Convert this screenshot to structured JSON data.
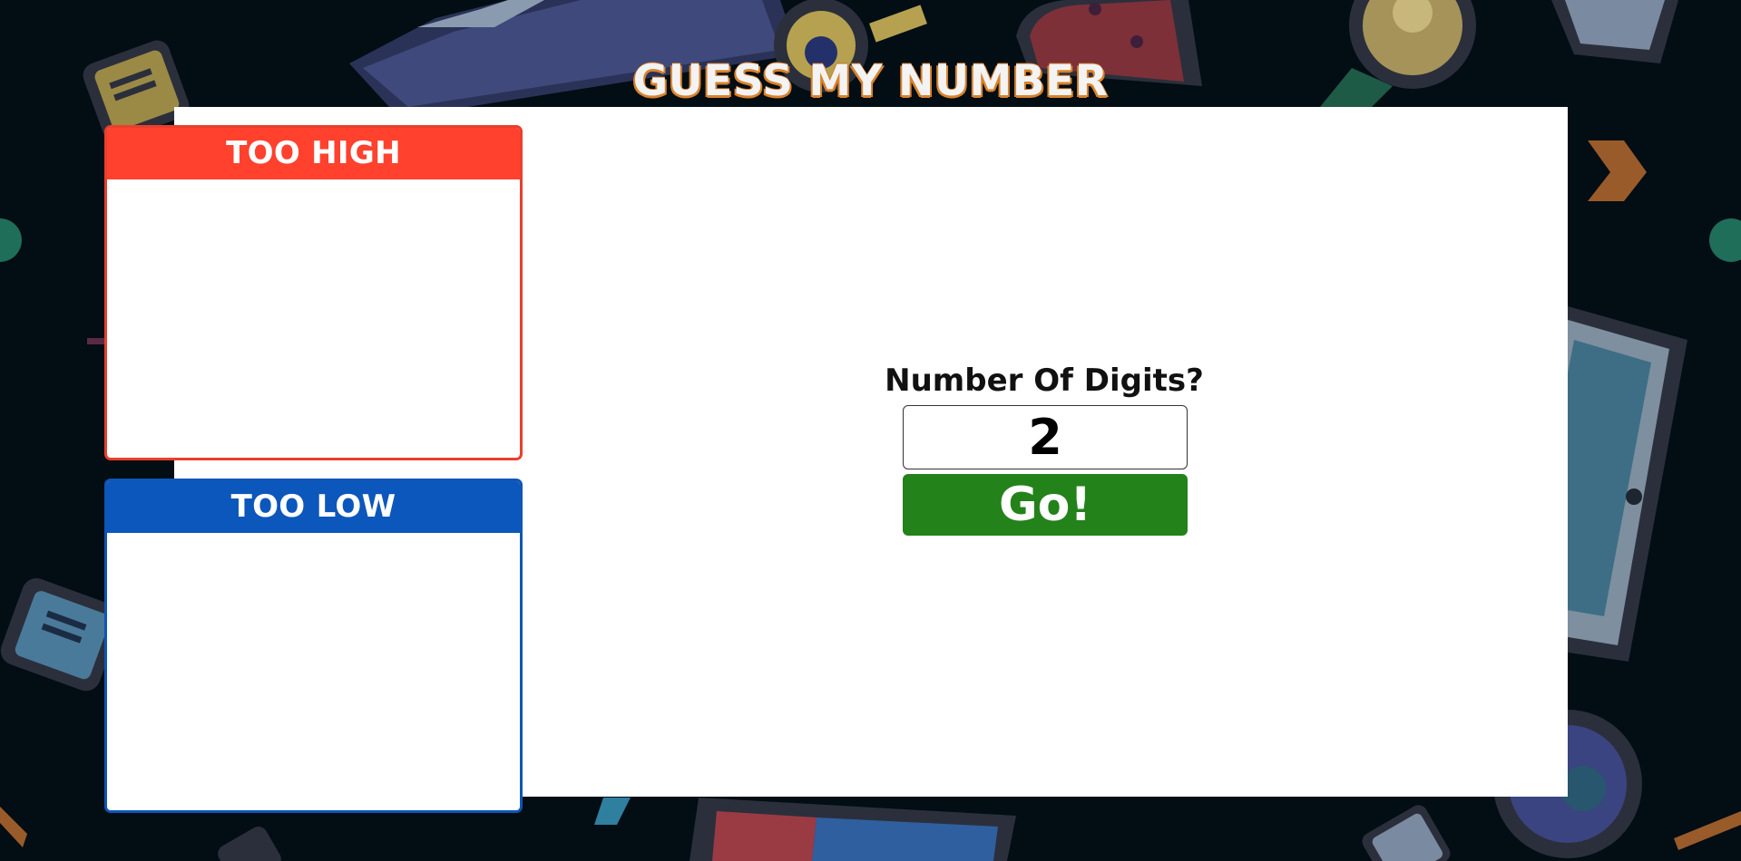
{
  "game": {
    "title": "GUESS MY NUMBER"
  },
  "lists": {
    "too_high": {
      "label": "TOO HIGH",
      "color": "#ff412e",
      "guesses": []
    },
    "too_low": {
      "label": "TOO LOW",
      "color": "#0c57bb",
      "guesses": []
    }
  },
  "setup": {
    "prompt": "Number Of Digits?",
    "digits_value": "2",
    "go_label": "Go!",
    "go_color": "#23821a"
  },
  "background": {
    "base_color": "#020d14",
    "decorations": [
      "folder-icon",
      "gear-icon",
      "flask-icon",
      "magnifier-icon",
      "cup-icon",
      "note-icon",
      "tablet-icon",
      "arrow-icon",
      "book-icon",
      "clock-icon",
      "document-icon"
    ]
  }
}
